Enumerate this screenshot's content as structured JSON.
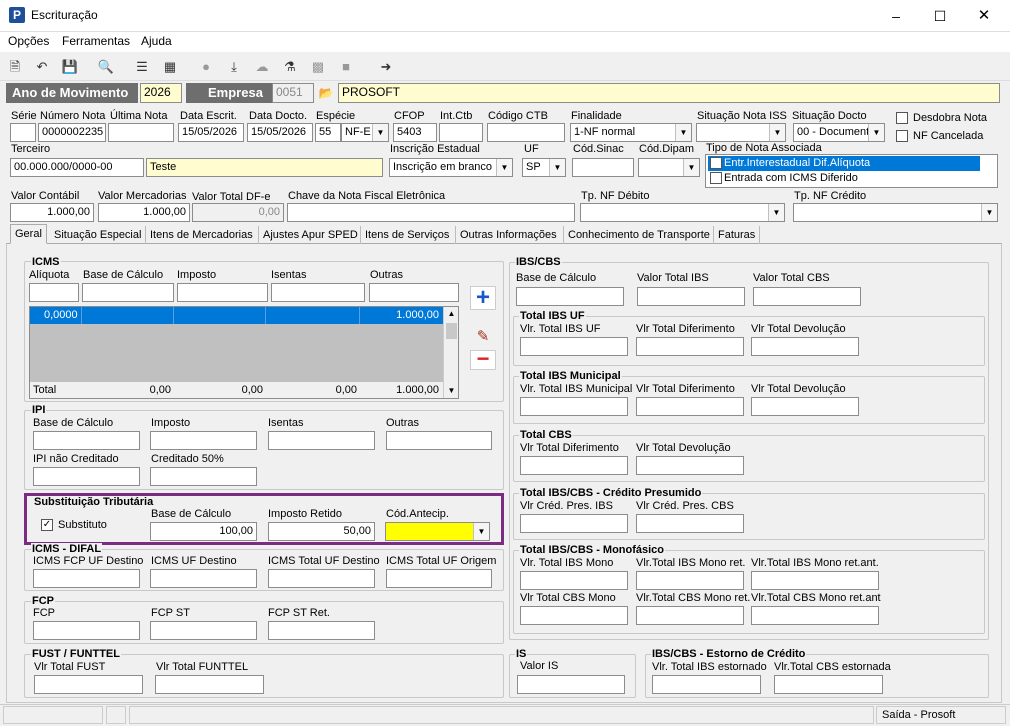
{
  "window": {
    "title": "Escrituração",
    "app_icon": "P"
  },
  "menu": [
    "Opções",
    "Ferramentas",
    "Ajuda"
  ],
  "header": {
    "ano_label": "Ano de Movimento",
    "ano_value": "2026",
    "empresa_label": "Empresa",
    "empresa_code": "0051",
    "empresa_name": "PROSOFT"
  },
  "labels": {
    "serie": "Série",
    "numero_nota": "Número Nota",
    "ultima_nota": "Última Nota",
    "data_escrit": "Data Escrit.",
    "data_docto": "Data Docto.",
    "especie": "Espécie",
    "cfop": "CFOP",
    "int_ctb": "Int.Ctb",
    "codigo_ctb": "Código CTB",
    "finalidade": "Finalidade",
    "situacao_nota_iss": "Situação Nota ISS",
    "situacao_docto": "Situação Docto",
    "terceiro": "Terceiro",
    "inscricao_estadual": "Inscrição Estadual",
    "uf": "UF",
    "cod_sinac": "Cód.Sinac",
    "cod_dipam": "Cód.Dipam",
    "tipo_nota_associada": "Tipo de Nota Associada",
    "valor_contabil": "Valor Contábil",
    "valor_mercadorias": "Valor Mercadorias",
    "valor_total_dfe": "Valor Total DF-e",
    "chave_nfe": "Chave da Nota Fiscal Eletrônica",
    "tp_nf_debito": "Tp. NF Débito",
    "tp_nf_credito": "Tp. NF Crédito"
  },
  "form": {
    "numero_nota": "0000002235",
    "data_escrit": "15/05/2026",
    "data_docto": "15/05/2026",
    "especie_code": "55",
    "especie": "NF-E",
    "cfop": "5403",
    "finalidade": "1-NF normal",
    "situacao_docto": "00 - Document",
    "terceiro_doc": "00.000.000/0000-00",
    "terceiro_nome": "Teste",
    "inscricao_estadual": "Inscrição em branco",
    "uf": "SP",
    "valor_contabil": "1.000,00",
    "valor_mercadorias": "1.000,00",
    "valor_total_dfe": "0,00"
  },
  "checkboxes": {
    "desdobra_nota": "Desdobra Nota",
    "nf_cancelada": "NF Cancelada"
  },
  "tipo_nota_options": [
    {
      "label": "Entr.Interestadual Dif.Alíquota",
      "checked": false,
      "selected": true
    },
    {
      "label": "Entrada com ICMS Diferido",
      "checked": false,
      "selected": false
    }
  ],
  "tabs": [
    "Geral",
    "Situação Especial",
    "Itens de Mercadorias",
    "Ajustes Apur SPED",
    "Itens de Serviços",
    "Outras Informações",
    "Conhecimento de Transporte",
    "Faturas"
  ],
  "icms": {
    "title": "ICMS",
    "cols": [
      "Alíquota",
      "Base de Cálculo",
      "Imposto",
      "Isentas",
      "Outras"
    ],
    "row": [
      "0,0000",
      "",
      "",
      "",
      "1.000,00"
    ],
    "total_label": "Total",
    "totals": [
      "0,00",
      "0,00",
      "0,00",
      "1.000,00"
    ]
  },
  "ipi": {
    "title": "IPI",
    "base": "Base de Cálculo",
    "imposto": "Imposto",
    "isentas": "Isentas",
    "outras": "Outras",
    "nao_creditado": "IPI não Creditado",
    "creditado": "Creditado 50%"
  },
  "st": {
    "title": "Substituição Tributária",
    "substituto": "Substituto",
    "base": "Base de Cálculo",
    "base_value": "100,00",
    "imposto_retido": "Imposto Retido",
    "imposto_value": "50,00",
    "cod_antecip": "Cód.Antecip."
  },
  "difal": {
    "title": "ICMS - DIFAL",
    "l1": "ICMS FCP UF Destino",
    "l2": "ICMS UF Destino",
    "l3": "ICMS Total UF Destino",
    "l4": "ICMS Total UF Origem"
  },
  "fcp": {
    "title": "FCP",
    "l1": "FCP",
    "l2": "FCP ST",
    "l3": "FCP ST Ret."
  },
  "fust": {
    "title": "FUST / FUNTTEL",
    "l1": "Vlr Total FUST",
    "l2": "Vlr Total FUNTTEL"
  },
  "ibscbs": {
    "title": "IBS/CBS",
    "l1": "Base de Cálculo",
    "l2": "Valor Total IBS",
    "l3": "Valor Total CBS"
  },
  "ibs_uf": {
    "title": "Total IBS UF",
    "l1": "Vlr. Total IBS UF",
    "l2": "Vlr Total Diferimento",
    "l3": "Vlr Total Devolução"
  },
  "ibs_mun": {
    "title": "Total IBS Municipal",
    "l1": "Vlr. Total IBS Municipal",
    "l2": "Vlr Total Diferimento",
    "l3": "Vlr Total Devolução"
  },
  "cbs": {
    "title": "Total CBS",
    "l1": "Vlr Total Diferimento",
    "l2": "Vlr Total Devolução"
  },
  "cred": {
    "title": "Total IBS/CBS - Crédito Presumido",
    "l1": "Vlr Créd. Pres. IBS",
    "l2": "Vlr Créd. Pres. CBS"
  },
  "mono": {
    "title": "Total IBS/CBS - Monofásico",
    "l1": "Vlr. Total IBS Mono",
    "l2": "Vlr.Total IBS Mono ret.",
    "l3": "Vlr.Total IBS Mono ret.ant.",
    "l4": "Vlr Total CBS Mono",
    "l5": "Vlr.Total CBS Mono ret.",
    "l6": "Vlr.Total CBS Mono ret.ant"
  },
  "is": {
    "title": "IS",
    "l1": "Valor IS"
  },
  "estorno": {
    "title": "IBS/CBS - Estorno de Crédito",
    "l1": "Vlr. Total IBS estornado",
    "l2": "Vlr.Total CBS estornada"
  },
  "status": {
    "right": "Saída - Prosoft"
  },
  "colors": {
    "selection": "#0078d7",
    "highlight": "#7b2c82",
    "yellow": "#ffff00"
  }
}
